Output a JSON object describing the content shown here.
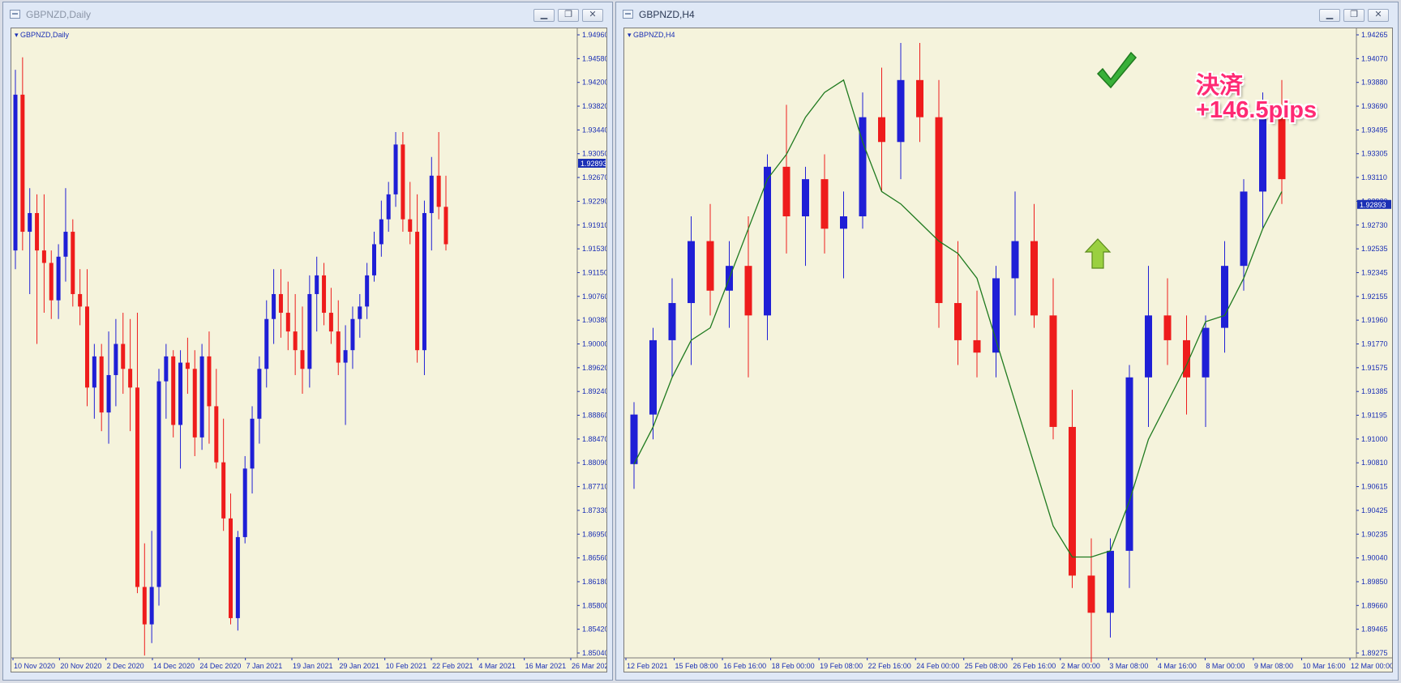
{
  "colors": {
    "bull": "#1f1fd6",
    "bear": "#ee1c1c",
    "ma": "#1f7a1f",
    "bg": "#f5f3dc",
    "axis": "#1a2fb5",
    "price_tag_bg": "#1a2fb5"
  },
  "left_window": {
    "title": "GBPNZD,Daily",
    "chart_label": "GBPNZD,Daily",
    "current_price": "1.92893",
    "price_labels": [
      "1.94960",
      "1.94580",
      "1.94200",
      "1.93820",
      "1.93440",
      "1.93050",
      "1.92670",
      "1.92290",
      "1.91910",
      "1.91530",
      "1.91150",
      "1.90760",
      "1.90380",
      "1.90000",
      "1.89620",
      "1.89240",
      "1.88860",
      "1.88470",
      "1.88090",
      "1.87710",
      "1.87330",
      "1.86950",
      "1.86560",
      "1.86180",
      "1.85800",
      "1.85420",
      "1.85040"
    ],
    "time_labels": [
      "10 Nov 2020",
      "20 Nov 2020",
      "2 Dec 2020",
      "14 Dec 2020",
      "24 Dec 2020",
      "7 Jan 2021",
      "19 Jan 2021",
      "29 Jan 2021",
      "10 Feb 2021",
      "22 Feb 2021",
      "4 Mar 2021",
      "16 Mar 2021",
      "26 Mar 2021"
    ]
  },
  "right_window": {
    "title": "GBPNZD,H4",
    "chart_label": "GBPNZD,H4",
    "current_price": "1.92893",
    "price_labels": [
      "1.94265",
      "1.94070",
      "1.93880",
      "1.93690",
      "1.93495",
      "1.93305",
      "1.93110",
      "1.92920",
      "1.92730",
      "1.92535",
      "1.92345",
      "1.92155",
      "1.91960",
      "1.91770",
      "1.91575",
      "1.91385",
      "1.91195",
      "1.91000",
      "1.90810",
      "1.90615",
      "1.90425",
      "1.90235",
      "1.90040",
      "1.89850",
      "1.89660",
      "1.89465",
      "1.89275"
    ],
    "time_labels": [
      "12 Feb 2021",
      "15 Feb 08:00",
      "16 Feb 16:00",
      "18 Feb 00:00",
      "19 Feb 08:00",
      "22 Feb 16:00",
      "24 Feb 00:00",
      "25 Feb 08:00",
      "26 Feb 16:00",
      "2 Mar 00:00",
      "3 Mar 08:00",
      "4 Mar 16:00",
      "8 Mar 00:00",
      "9 Mar 08:00",
      "10 Mar 16:00",
      "12 Mar 00:00"
    ],
    "annotation": {
      "line1": "決済",
      "line2": "+146.5pips"
    },
    "icons": [
      "checkmark-icon",
      "up-arrow-icon"
    ]
  },
  "chart_data": [
    {
      "type": "candlestick",
      "title": "GBPNZD,Daily",
      "ylim": [
        1.8504,
        1.9496
      ],
      "candles": [
        [
          1.915,
          1.944,
          1.912,
          1.94
        ],
        [
          1.94,
          1.946,
          1.915,
          1.918
        ],
        [
          1.918,
          1.925,
          1.908,
          1.921
        ],
        [
          1.921,
          1.924,
          1.9,
          1.915
        ],
        [
          1.915,
          1.924,
          1.905,
          1.913
        ],
        [
          1.913,
          1.915,
          1.904,
          1.907
        ],
        [
          1.907,
          1.916,
          1.904,
          1.914
        ],
        [
          1.914,
          1.925,
          1.91,
          1.918
        ],
        [
          1.918,
          1.92,
          1.906,
          1.908
        ],
        [
          1.908,
          1.912,
          1.903,
          1.906
        ],
        [
          1.906,
          1.912,
          1.89,
          1.893
        ],
        [
          1.893,
          1.9,
          1.888,
          1.898
        ],
        [
          1.898,
          1.9,
          1.886,
          1.889
        ],
        [
          1.889,
          1.902,
          1.884,
          1.895
        ],
        [
          1.895,
          1.904,
          1.89,
          1.9
        ],
        [
          1.9,
          1.905,
          1.892,
          1.896
        ],
        [
          1.896,
          1.904,
          1.886,
          1.893
        ],
        [
          1.893,
          1.905,
          1.86,
          1.861
        ],
        [
          1.861,
          1.868,
          1.85,
          1.855
        ],
        [
          1.855,
          1.87,
          1.852,
          1.861
        ],
        [
          1.861,
          1.896,
          1.858,
          1.894
        ],
        [
          1.894,
          1.9,
          1.888,
          1.898
        ],
        [
          1.898,
          1.899,
          1.885,
          1.887
        ],
        [
          1.887,
          1.899,
          1.88,
          1.897
        ],
        [
          1.897,
          1.901,
          1.892,
          1.896
        ],
        [
          1.896,
          1.899,
          1.882,
          1.885
        ],
        [
          1.885,
          1.9,
          1.883,
          1.898
        ],
        [
          1.898,
          1.902,
          1.884,
          1.89
        ],
        [
          1.89,
          1.896,
          1.88,
          1.881
        ],
        [
          1.881,
          1.888,
          1.87,
          1.872
        ],
        [
          1.872,
          1.876,
          1.855,
          1.856
        ],
        [
          1.856,
          1.87,
          1.854,
          1.869
        ],
        [
          1.869,
          1.882,
          1.868,
          1.88
        ],
        [
          1.88,
          1.89,
          1.876,
          1.888
        ],
        [
          1.888,
          1.898,
          1.884,
          1.896
        ],
        [
          1.896,
          1.907,
          1.893,
          1.904
        ],
        [
          1.904,
          1.912,
          1.9,
          1.908
        ],
        [
          1.908,
          1.912,
          1.901,
          1.905
        ],
        [
          1.905,
          1.91,
          1.899,
          1.902
        ],
        [
          1.902,
          1.908,
          1.895,
          1.899
        ],
        [
          1.899,
          1.906,
          1.892,
          1.896
        ],
        [
          1.896,
          1.911,
          1.893,
          1.908
        ],
        [
          1.908,
          1.914,
          1.902,
          1.911
        ],
        [
          1.911,
          1.913,
          1.903,
          1.905
        ],
        [
          1.905,
          1.909,
          1.9,
          1.902
        ],
        [
          1.902,
          1.907,
          1.895,
          1.897
        ],
        [
          1.897,
          1.903,
          1.887,
          1.899
        ],
        [
          1.899,
          1.906,
          1.896,
          1.904
        ],
        [
          1.904,
          1.908,
          1.901,
          1.906
        ],
        [
          1.906,
          1.913,
          1.904,
          1.911
        ],
        [
          1.911,
          1.918,
          1.91,
          1.916
        ],
        [
          1.916,
          1.923,
          1.914,
          1.92
        ],
        [
          1.92,
          1.926,
          1.918,
          1.924
        ],
        [
          1.924,
          1.934,
          1.922,
          1.932
        ],
        [
          1.932,
          1.934,
          1.918,
          1.92
        ],
        [
          1.92,
          1.926,
          1.916,
          1.918
        ],
        [
          1.918,
          1.924,
          1.897,
          1.899
        ],
        [
          1.899,
          1.923,
          1.895,
          1.921
        ],
        [
          1.921,
          1.93,
          1.915,
          1.927
        ],
        [
          1.927,
          1.934,
          1.92,
          1.922
        ],
        [
          1.922,
          1.927,
          1.915,
          1.916
        ]
      ]
    },
    {
      "type": "candlestick",
      "title": "GBPNZD,H4",
      "ylim": [
        1.89275,
        1.94265
      ],
      "ma": [
        1.908,
        1.911,
        1.915,
        1.918,
        1.919,
        1.923,
        1.927,
        1.931,
        1.933,
        1.936,
        1.938,
        1.939,
        1.934,
        1.93,
        1.929,
        1.9275,
        1.926,
        1.925,
        1.923,
        1.918,
        1.913,
        1.908,
        1.903,
        1.9005,
        1.9005,
        1.901,
        1.905,
        1.91,
        1.913,
        1.916,
        1.9195,
        1.92,
        1.923,
        1.927,
        1.93
      ],
      "candles": [
        [
          1.908,
          1.913,
          1.906,
          1.912
        ],
        [
          1.912,
          1.919,
          1.91,
          1.918
        ],
        [
          1.918,
          1.923,
          1.915,
          1.921
        ],
        [
          1.921,
          1.928,
          1.916,
          1.926
        ],
        [
          1.926,
          1.929,
          1.92,
          1.922
        ],
        [
          1.922,
          1.926,
          1.919,
          1.924
        ],
        [
          1.924,
          1.928,
          1.915,
          1.92
        ],
        [
          1.92,
          1.933,
          1.918,
          1.932
        ],
        [
          1.932,
          1.937,
          1.925,
          1.928
        ],
        [
          1.928,
          1.932,
          1.924,
          1.931
        ],
        [
          1.931,
          1.933,
          1.925,
          1.927
        ],
        [
          1.927,
          1.93,
          1.923,
          1.928
        ],
        [
          1.928,
          1.938,
          1.927,
          1.936
        ],
        [
          1.936,
          1.94,
          1.93,
          1.934
        ],
        [
          1.934,
          1.942,
          1.931,
          1.939
        ],
        [
          1.939,
          1.942,
          1.934,
          1.936
        ],
        [
          1.936,
          1.939,
          1.919,
          1.921
        ],
        [
          1.921,
          1.926,
          1.916,
          1.918
        ],
        [
          1.918,
          1.922,
          1.915,
          1.917
        ],
        [
          1.917,
          1.924,
          1.915,
          1.923
        ],
        [
          1.923,
          1.93,
          1.92,
          1.926
        ],
        [
          1.926,
          1.929,
          1.919,
          1.92
        ],
        [
          1.92,
          1.923,
          1.91,
          1.911
        ],
        [
          1.911,
          1.914,
          1.898,
          1.899
        ],
        [
          1.899,
          1.902,
          1.892,
          1.896
        ],
        [
          1.896,
          1.902,
          1.894,
          1.901
        ],
        [
          1.901,
          1.916,
          1.898,
          1.915
        ],
        [
          1.915,
          1.924,
          1.911,
          1.92
        ],
        [
          1.92,
          1.923,
          1.916,
          1.918
        ],
        [
          1.918,
          1.92,
          1.912,
          1.915
        ],
        [
          1.915,
          1.92,
          1.911,
          1.919
        ],
        [
          1.919,
          1.926,
          1.917,
          1.924
        ],
        [
          1.924,
          1.931,
          1.922,
          1.93
        ],
        [
          1.93,
          1.938,
          1.927,
          1.937
        ],
        [
          1.937,
          1.939,
          1.929,
          1.931
        ]
      ]
    }
  ]
}
